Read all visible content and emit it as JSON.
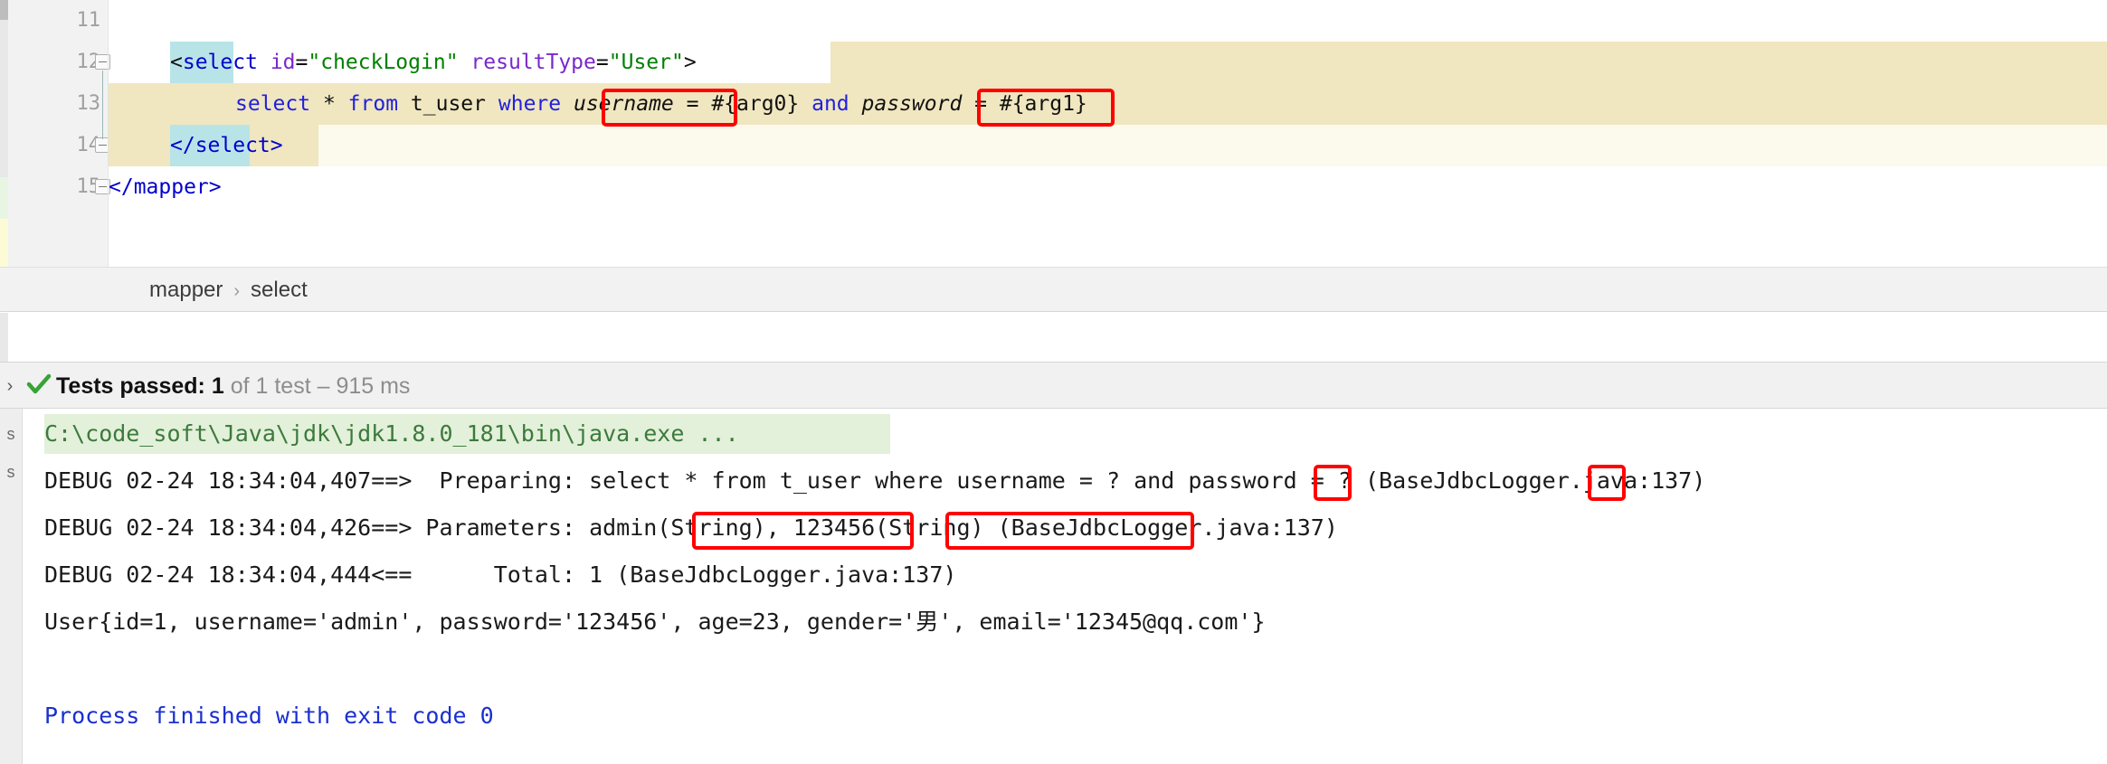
{
  "editor": {
    "lines": [
      {
        "number": "11",
        "text": ""
      },
      {
        "number": "12",
        "text": "<select id=\"checkLogin\" resultType=\"User\">"
      },
      {
        "number": "13",
        "text": "select * from t_user where username = #{arg0} and password = #{arg1}"
      },
      {
        "number": "14",
        "text": "</select>"
      },
      {
        "number": "15",
        "text": "</mapper>"
      }
    ],
    "tokens": {
      "open_angle": "<",
      "tag_select": "select",
      "attr_id": "id",
      "eq": "=",
      "val_checkLogin": "\"checkLogin\"",
      "attr_resultType": "resultType",
      "val_User": "\"User\"",
      "close_angle": ">",
      "sql_select": "select",
      "star": "*",
      "sql_from": "from",
      "table": "t_user",
      "sql_where": "where",
      "col_username": "username",
      "arg0": "#{arg0}",
      "sql_and": "and",
      "col_password": "password",
      "arg1": "#{arg1}",
      "close_select": "</select>",
      "close_mapper": "</mapper>"
    },
    "breadcrumb": {
      "items": [
        "mapper",
        "select"
      ],
      "separator": "›"
    }
  },
  "test_status": {
    "expand_arrow": "›",
    "check_icon": "check-icon",
    "label": "Tests passed:",
    "count": "1",
    "of_text": "of 1 test – 915 ms"
  },
  "console": {
    "side_tabs": [
      "s",
      "s"
    ],
    "lines": [
      {
        "id": "java-path",
        "text": "C:\\code_soft\\Java\\jdk\\jdk1.8.0_181\\bin\\java.exe ...",
        "style": "green-highlight"
      },
      {
        "id": "debug-preparing",
        "text": "DEBUG 02-24 18:34:04,407==>  Preparing: select * from t_user where username = ? and password = ? (BaseJdbcLogger.java:137)",
        "style": "plain"
      },
      {
        "id": "debug-parameters",
        "text": "DEBUG 02-24 18:34:04,426==> Parameters: admin(String), 123456(String) (BaseJdbcLogger.java:137)",
        "style": "plain"
      },
      {
        "id": "debug-total",
        "text": "DEBUG 02-24 18:34:04,444<==      Total: 1 (BaseJdbcLogger.java:137)",
        "style": "plain"
      },
      {
        "id": "user-result",
        "text": "User{id=1, username='admin', password='123456', age=23, gender='男', email='12345@qq.com'}",
        "style": "plain"
      },
      {
        "id": "process-finished",
        "text": "Process finished with exit code 0",
        "style": "blue"
      }
    ],
    "preparing_parts": {
      "prefix": "DEBUG 02-24 18:34:04,407==>  Preparing: select * from t_user where username = ",
      "q1": "?",
      "mid": " and password = ",
      "q2": "?",
      "suffix": " (BaseJdbcLogger.java:137)"
    },
    "parameters_parts": {
      "prefix": "DEBUG 02-24 18:34:04,426==> Parameters: ",
      "p1": "admin(String)",
      "comma": ", ",
      "p2": "123456(String)",
      "suffix": " (BaseJdbcLogger.java:137)"
    }
  },
  "annotations": {
    "boxes": [
      {
        "name": "arg0-highlight-box"
      },
      {
        "name": "arg1-highlight-box"
      },
      {
        "name": "question-mark-1-box"
      },
      {
        "name": "question-mark-2-box"
      },
      {
        "name": "param-admin-box"
      },
      {
        "name": "param-123456-box"
      }
    ],
    "color": "#ff0000"
  },
  "colors": {
    "accent_red": "#ff0000",
    "highlight_yellow": "#f0e6c0",
    "selection_cyan": "#b8e4e8",
    "console_green": "#e3f0da",
    "link_green": "#3c7a3c",
    "process_blue": "#1a2fd0"
  }
}
